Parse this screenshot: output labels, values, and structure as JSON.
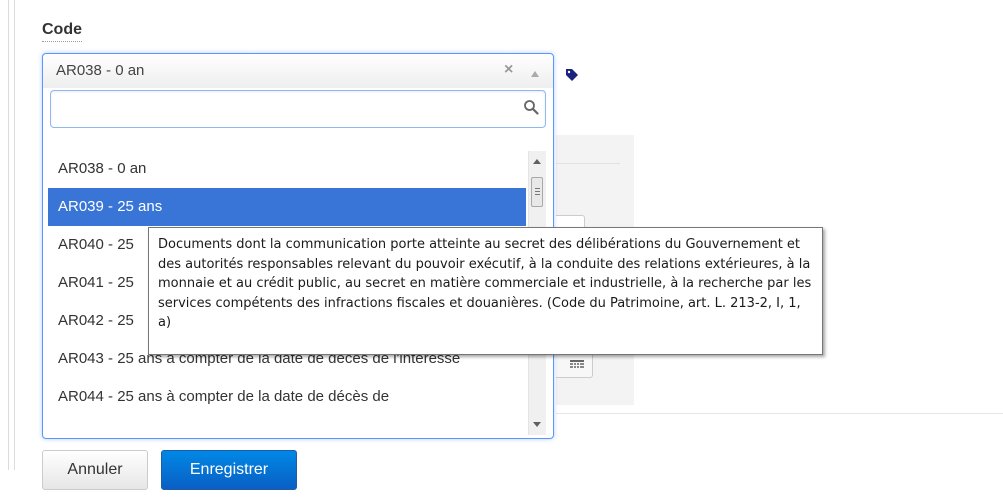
{
  "field": {
    "label": "Code"
  },
  "select": {
    "selected_value": "AR038 - 0 an",
    "clear_symbol": "×",
    "search": {
      "value": "",
      "placeholder": ""
    },
    "options": [
      {
        "label": "AR038 - 0 an",
        "highlighted": false
      },
      {
        "label": "AR039 - 25 ans",
        "highlighted": true
      },
      {
        "label": "AR040 - 25",
        "highlighted": false
      },
      {
        "label": "AR041 - 25",
        "highlighted": false
      },
      {
        "label": "AR042 - 25",
        "highlighted": false
      },
      {
        "label": "AR043 - 25 ans à compter de la date de décès de l'intéressé",
        "highlighted": false
      },
      {
        "label": "AR044 - 25 ans à compter de la date de décès de",
        "highlighted": false
      }
    ]
  },
  "tooltip": {
    "text": "Documents dont la communication porte atteinte au secret des délibérations du Gouvernement et des autorités responsables relevant du pouvoir exécutif, à la conduite des relations extérieures, à la monnaie et au crédit public, au secret en matière commerciale et industrielle, à la recherche par les services compétents des infractions fiscales et douanières. (Code du Patrimoine, art. L. 213-2, I, 1, a)"
  },
  "buttons": {
    "cancel_label": "Annuler",
    "save_label": "Enregistrer"
  },
  "icons": {
    "tag": "tag-icon",
    "search": "search-icon",
    "calendar": "calendar-icon"
  },
  "colors": {
    "accent": "#3875d7",
    "primary_button": "#0a6fd6",
    "tag": "#1a237e"
  }
}
